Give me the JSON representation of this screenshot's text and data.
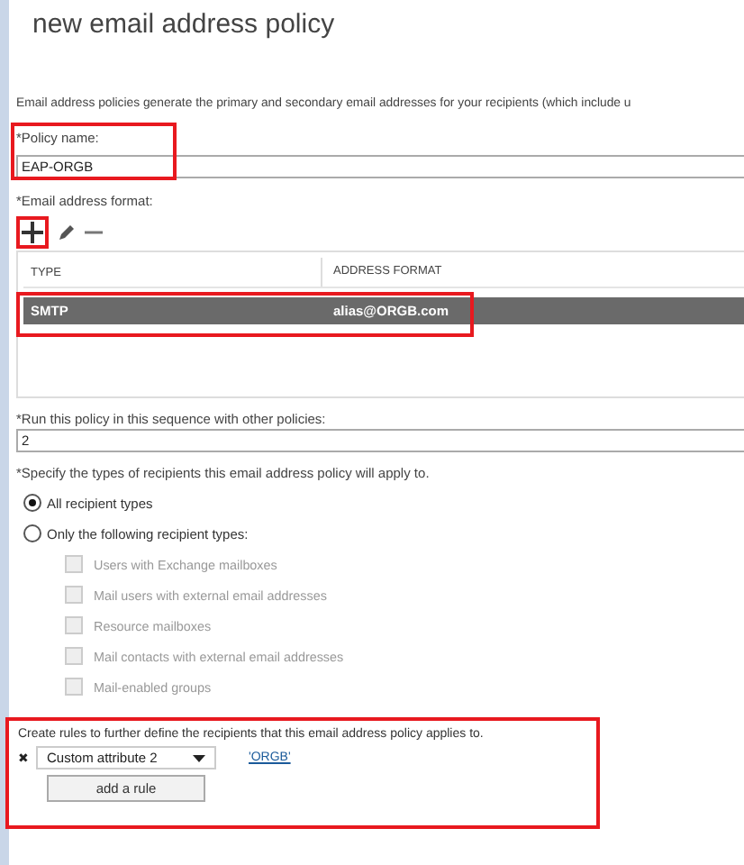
{
  "title": "new email address policy",
  "description": "Email address policies generate the primary and secondary email addresses for your recipients (which include u",
  "policy_name": {
    "label": "*Policy name:",
    "value": "EAP-ORGB",
    "highlighted": true
  },
  "format": {
    "label": "*Email address format:",
    "add_highlighted": true,
    "columns": [
      "TYPE",
      "ADDRESS FORMAT"
    ],
    "rows": [
      {
        "type": "SMTP",
        "address": "alias@ORGB.com",
        "selected": true,
        "highlighted": true
      }
    ]
  },
  "sequence": {
    "label": "*Run this policy in this sequence with other policies:",
    "value": "2"
  },
  "recipients": {
    "label": "*Specify the types of recipients this email address policy will apply to.",
    "options": [
      {
        "label": "All recipient types",
        "selected": true
      },
      {
        "label": "Only the following recipient types:",
        "selected": false
      }
    ],
    "types": [
      {
        "label": "Users with Exchange mailboxes",
        "checked": false,
        "disabled": true
      },
      {
        "label": "Mail users with external email addresses",
        "checked": false,
        "disabled": true
      },
      {
        "label": "Resource mailboxes",
        "checked": false,
        "disabled": true
      },
      {
        "label": "Mail contacts with external email addresses",
        "checked": false,
        "disabled": true
      },
      {
        "label": "Mail-enabled groups",
        "checked": false,
        "disabled": true
      }
    ]
  },
  "rules": {
    "highlighted": true,
    "label": "Create rules to further define the recipients that this email address policy applies to.",
    "items": [
      {
        "remove": "✖",
        "condition": "Custom attribute 2",
        "value": "'ORGB'"
      }
    ],
    "add_button": "add a rule"
  }
}
